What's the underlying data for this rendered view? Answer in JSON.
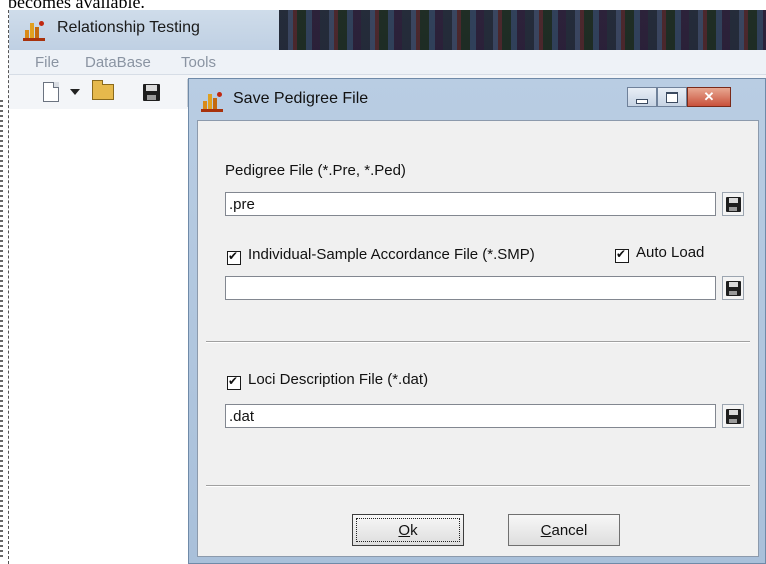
{
  "caption": {
    "text": "becomes available."
  },
  "parent_window": {
    "title": "Relationship Testing",
    "menu": [
      "File",
      "DataBase",
      "Tools"
    ],
    "toolbar": {
      "icons": [
        "new-document-icon",
        "dropdown-arrow-icon",
        "open-folder-icon",
        "save-disk-icon"
      ]
    }
  },
  "dialog": {
    "title": "Save Pedigree File",
    "pedigree": {
      "label": "Pedigree File (*.Pre, *.Ped)",
      "value": ".pre"
    },
    "accordance": {
      "label": "Individual-Sample Accordance File (*.SMP)",
      "checked": true,
      "value": "",
      "auto_load": {
        "label": "Auto Load",
        "checked": true
      }
    },
    "loci": {
      "label": "Loci Description File (*.dat)",
      "checked": true,
      "value": ".dat"
    },
    "buttons": {
      "ok": {
        "accel": "O",
        "rest": "k"
      },
      "cancel": {
        "accel": "C",
        "rest": "ancel"
      }
    }
  },
  "colors": {
    "title_bar": "#bfd0e3",
    "dialog_frame": "#a9c0da",
    "client_bg": "#f0f0f0",
    "close_button": "#c9513b"
  }
}
